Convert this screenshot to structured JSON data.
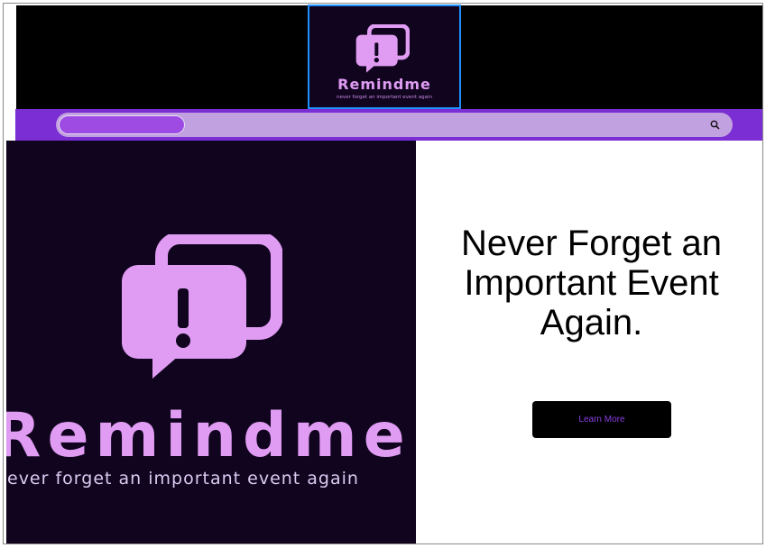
{
  "brand": {
    "name": "Remindme",
    "tagline": "never forget an important event again",
    "hero_tagline": "ever forget an important event again"
  },
  "search": {
    "placeholder": ""
  },
  "hero": {
    "headline_line1": "Never Forget an",
    "headline_line2": "Important Event",
    "headline_line3": "Again.",
    "cta_label": "Learn More"
  },
  "icons": {
    "logo": "chat-bubbles-alert-icon",
    "search": "search-icon"
  },
  "colors": {
    "header_bg": "#000000",
    "logo_bg": "#10041f",
    "brand_pink": "#e09cf3",
    "search_band": "#7b2ed4",
    "search_bar": "#c2a1e0",
    "cta_bg": "#000000",
    "cta_text": "#8a3fe0"
  }
}
